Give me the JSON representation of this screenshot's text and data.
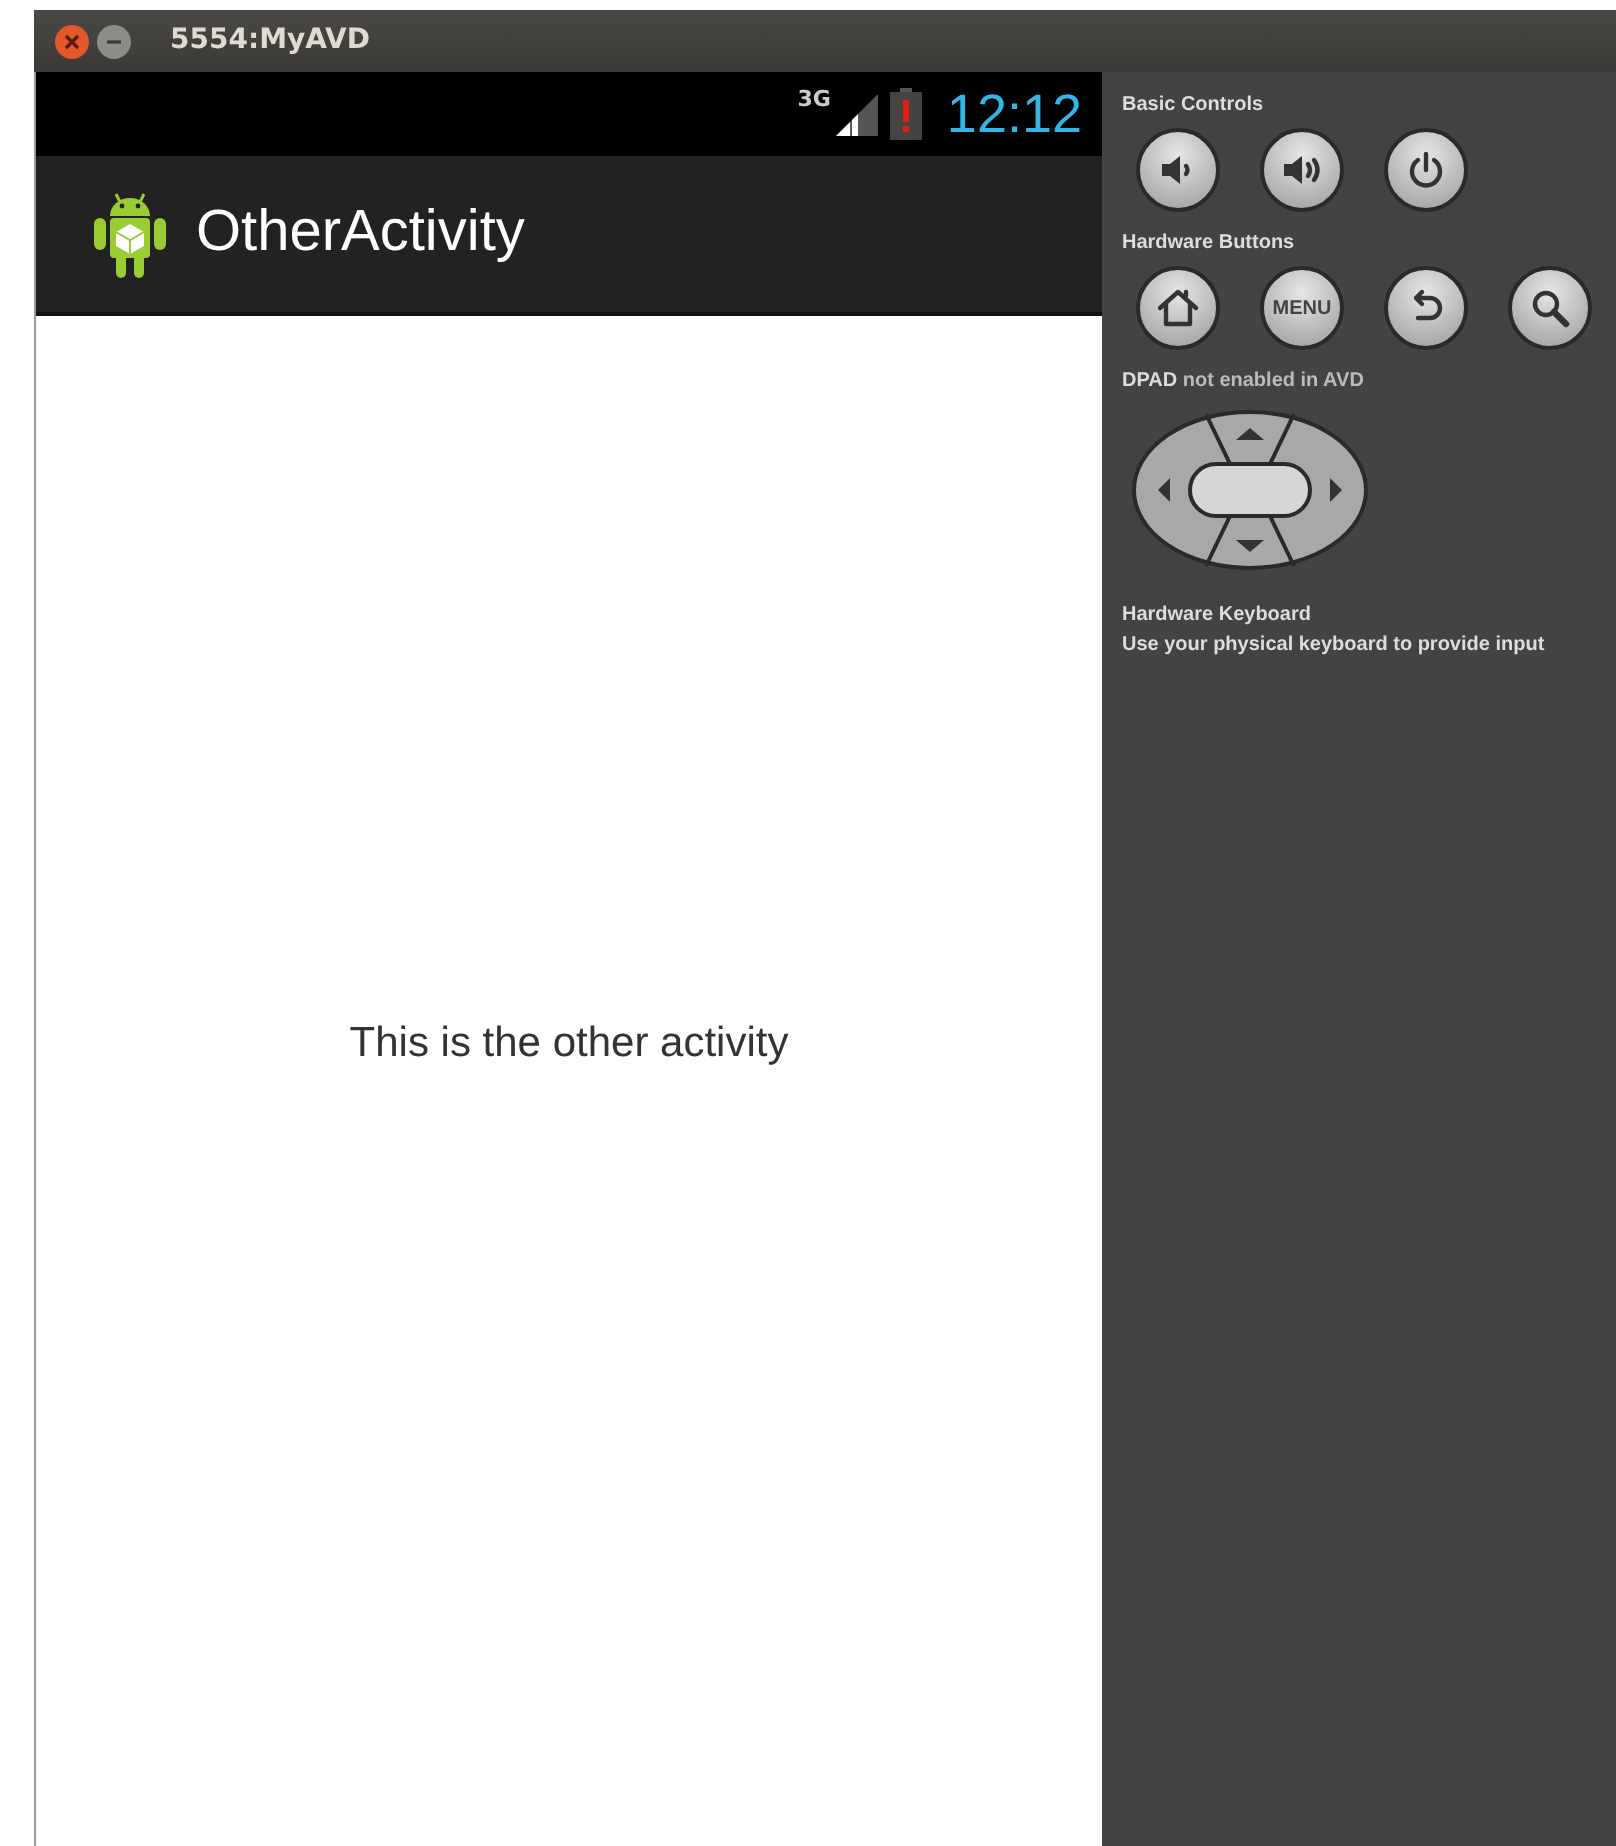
{
  "window": {
    "title": "5554:MyAVD"
  },
  "status_bar": {
    "network": "3G",
    "time": "12:12"
  },
  "action_bar": {
    "title": "OtherActivity"
  },
  "content": {
    "text": "This is the other activity"
  },
  "controls_panel": {
    "sections": [
      {
        "title": "Basic Controls",
        "keys": [
          {
            "kind": "volume-down"
          },
          {
            "kind": "volume-up"
          },
          {
            "kind": "power"
          }
        ]
      },
      {
        "title": "Hardware Buttons",
        "keys": [
          {
            "kind": "home"
          },
          {
            "kind": "menu",
            "label": "MENU"
          },
          {
            "kind": "back"
          },
          {
            "kind": "search"
          }
        ]
      }
    ],
    "dpad": {
      "caption": "**DPAD** not enabled in AVD"
    },
    "keyboard": {
      "title": "Hardware Keyboard",
      "hint": "Use your physical keyboard to provide input"
    }
  }
}
